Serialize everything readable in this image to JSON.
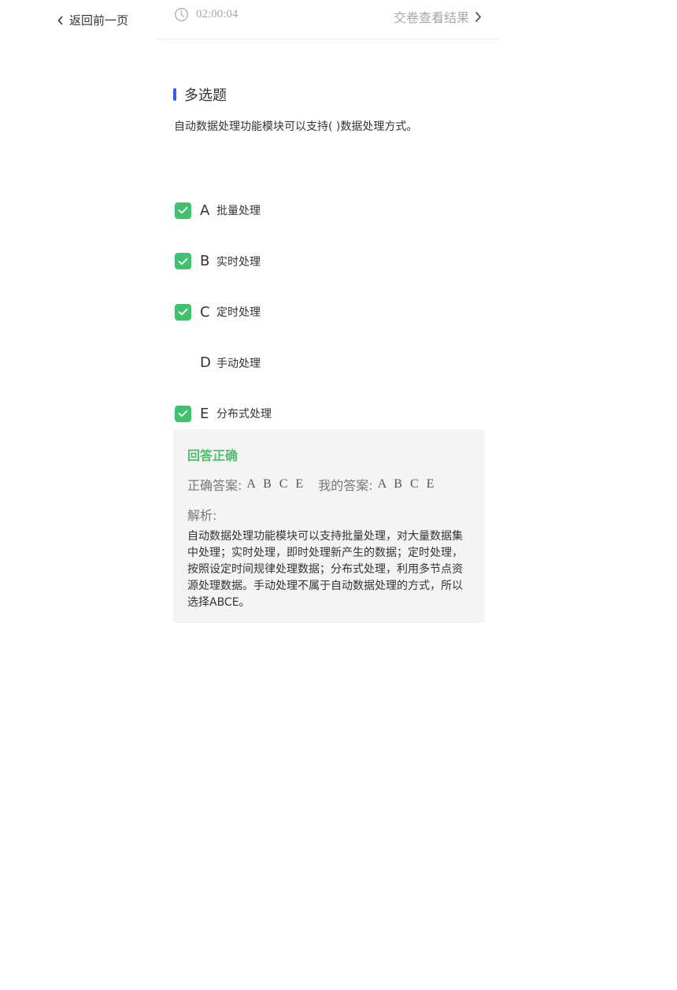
{
  "nav": {
    "back_label": "返回前一页",
    "timer": "02:00:04",
    "submit_label": "交卷查看结果"
  },
  "question": {
    "type_label": "多选题",
    "text": "自动数据处理功能模块可以支持( )数据处理方式。",
    "options": [
      {
        "letter": "A",
        "text": "批量处理",
        "checked": true
      },
      {
        "letter": "B",
        "text": "实时处理",
        "checked": true
      },
      {
        "letter": "C",
        "text": "定时处理",
        "checked": true
      },
      {
        "letter": "D",
        "text": "手动处理",
        "checked": false
      },
      {
        "letter": "E",
        "text": "分布式处理",
        "checked": true
      }
    ]
  },
  "result": {
    "status": "回答正确",
    "status_color": "#4fbf6c",
    "correct_label": "正确答案:",
    "correct_value": "A B C E",
    "mine_label": "我的答案:",
    "mine_value": "A B C E",
    "analysis_label": "解析:",
    "analysis_text": "自动数据处理功能模块可以支持批量处理，对大量数据集中处理；实时处理，即时处理新产生的数据；定时处理，按照设定时间规律处理数据；分布式处理，利用多节点资源处理数据。手动处理不属于自动数据处理的方式，所以选择ABCE。"
  },
  "colors": {
    "accent_bar": "#3d5ce6",
    "checkbox": "#3fc16d",
    "muted": "#a7a7a7"
  }
}
